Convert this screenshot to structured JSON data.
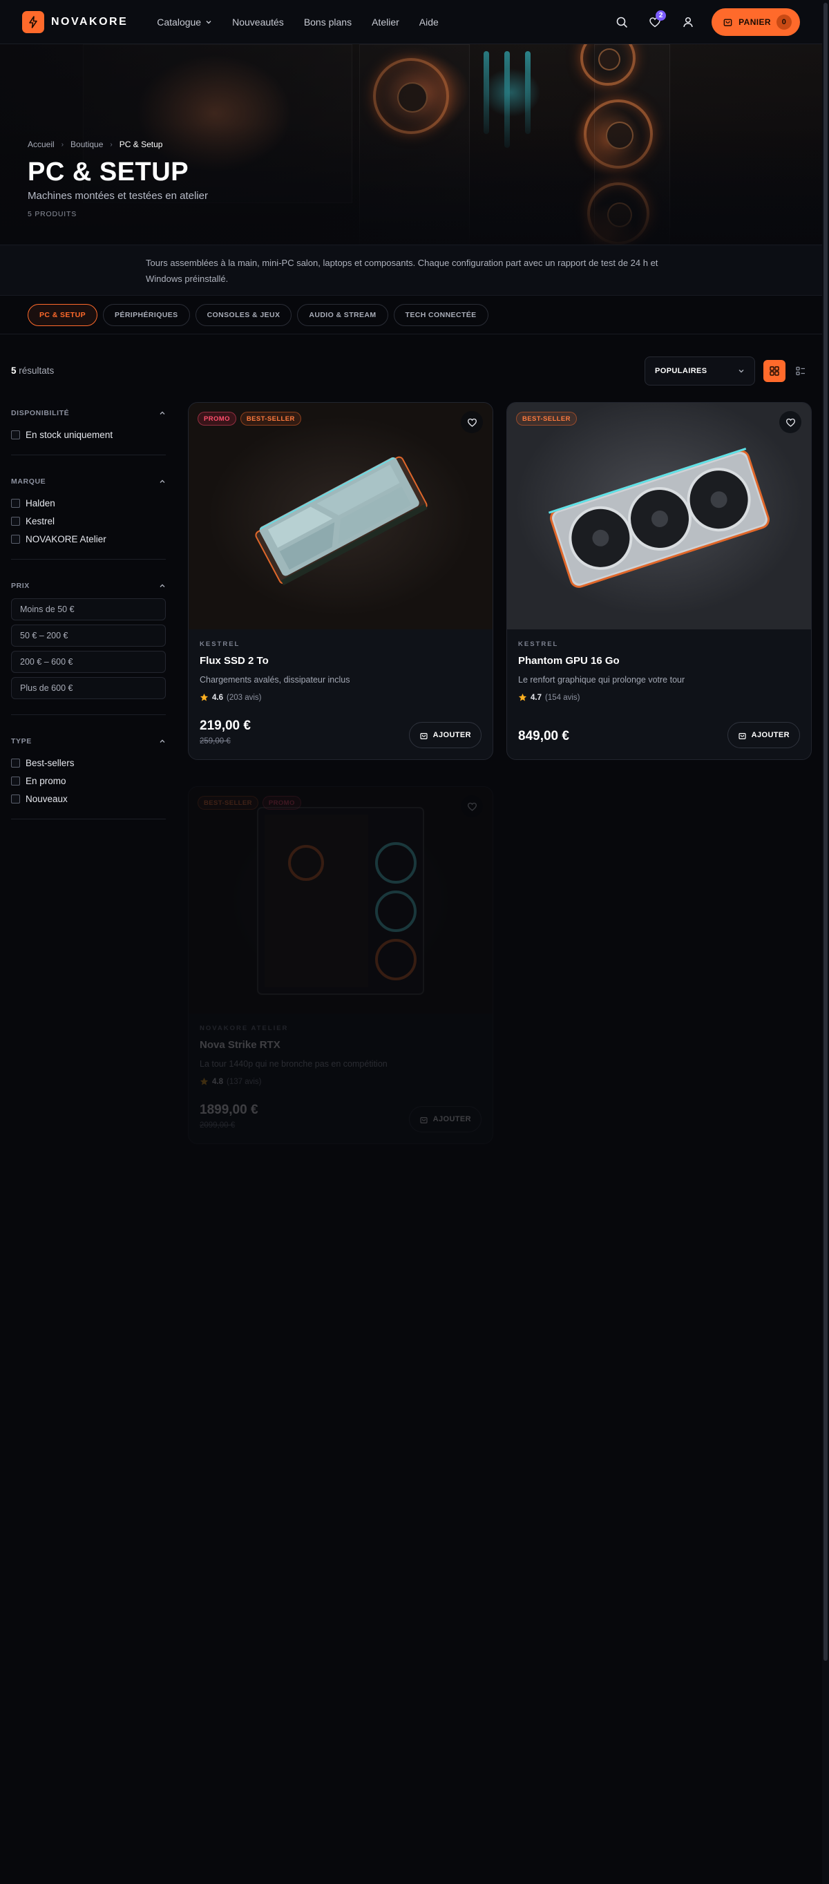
{
  "brand": {
    "name": "NOVAKORE"
  },
  "nav": {
    "items": [
      {
        "label": "Catalogue"
      },
      {
        "label": "Nouveautés"
      },
      {
        "label": "Bons plans"
      },
      {
        "label": "Atelier"
      },
      {
        "label": "Aide"
      }
    ]
  },
  "header": {
    "wishlist_count": "2",
    "cart_label": "PANIER",
    "cart_count": "0"
  },
  "hero": {
    "breadcrumb": [
      "Accueil",
      "Boutique",
      "PC & Setup"
    ],
    "title": "PC & SETUP",
    "subtitle": "Machines montées et testées en atelier",
    "count": "5 PRODUITS"
  },
  "description": "Tours assemblées à la main, mini-PC salon, laptops et composants. Chaque configuration part avec un rapport de test de 24 h et Windows préinstallé.",
  "categories": [
    "PC & SETUP",
    "PÉRIPHÉRIQUES",
    "CONSOLES & JEUX",
    "AUDIO & STREAM",
    "TECH CONNECTÉE"
  ],
  "toolbar": {
    "results_count": "5",
    "results_label": "résultats",
    "sort_value": "POPULAIRES"
  },
  "filters": {
    "availability": {
      "title": "DISPONIBILITÉ",
      "options": [
        "En stock uniquement"
      ]
    },
    "brand": {
      "title": "MARQUE",
      "options": [
        "Halden",
        "Kestrel",
        "NOVAKORE Atelier"
      ]
    },
    "price": {
      "title": "PRIX",
      "options": [
        "Moins de 50 €",
        "50 € – 200 €",
        "200 € – 600 €",
        "Plus de 600 €"
      ]
    },
    "type": {
      "title": "TYPE",
      "options": [
        "Best-sellers",
        "En promo",
        "Nouveaux"
      ]
    }
  },
  "products": [
    {
      "brand": "KESTREL",
      "name": "Flux SSD 2 To",
      "description": "Chargements avalés, dissipateur inclus",
      "rating": "4.6",
      "reviews": "(203 avis)",
      "price": "219,00 €",
      "old_price": "259,00 €",
      "tags": [
        "PROMO",
        "BEST-SELLER"
      ],
      "add_label": "AJOUTER"
    },
    {
      "brand": "KESTREL",
      "name": "Phantom GPU 16 Go",
      "description": "Le renfort graphique qui prolonge votre tour",
      "rating": "4.7",
      "reviews": "(154 avis)",
      "price": "849,00 €",
      "tags": [
        "BEST-SELLER"
      ],
      "add_label": "AJOUTER"
    },
    {
      "brand": "NOVAKORE ATELIER",
      "name": "Nova Strike RTX",
      "description": "La tour 1440p qui ne bronche pas en compétition",
      "rating": "4.8",
      "reviews": "(137 avis)",
      "price": "1899,00 €",
      "old_price": "2099,00 €",
      "tags": [
        "BEST-SELLER",
        "PROMO"
      ],
      "add_label": "AJOUTER"
    }
  ],
  "colors": {
    "accent": "#ff6a2b",
    "background": "#07080c",
    "card": "#0f1218",
    "badge": "#7c5cff",
    "star": "#ffb020"
  }
}
